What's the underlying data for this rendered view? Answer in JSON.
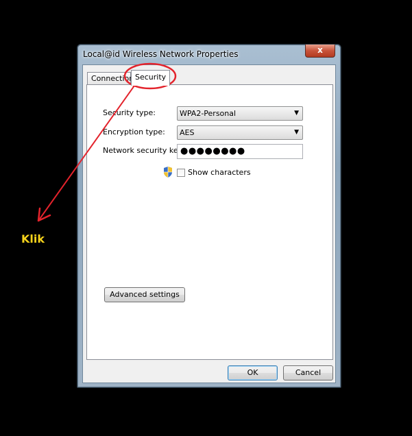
{
  "window": {
    "title": "Local@id Wireless Network Properties",
    "close_label": "x"
  },
  "tabs": [
    {
      "label": "Connection",
      "selected": false
    },
    {
      "label": "Security",
      "selected": true
    }
  ],
  "security": {
    "security_type_label": "Security type:",
    "security_type_value": "WPA2-Personal",
    "encryption_type_label": "Encryption type:",
    "encryption_type_value": "AES",
    "network_key_label": "Network security key",
    "network_key_value": "●●●●●●●●",
    "show_characters_label": "Show characters",
    "show_characters_checked": false,
    "advanced_button": "Advanced settings"
  },
  "buttons": {
    "ok": "OK",
    "cancel": "Cancel"
  },
  "annotation": {
    "text": "Klik",
    "color": "#f6d21b",
    "arrow_color": "#e3232c"
  }
}
